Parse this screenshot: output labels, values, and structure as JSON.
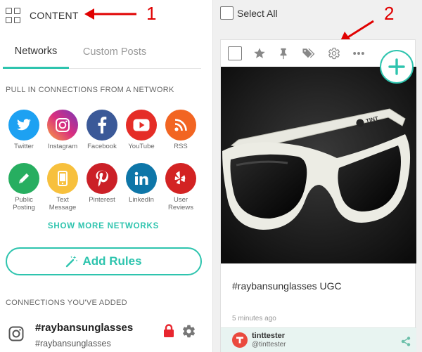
{
  "left_panel": {
    "header_title": "CONTENT",
    "tabs": [
      {
        "label": "Networks",
        "active": true
      },
      {
        "label": "Custom Posts",
        "active": false
      }
    ],
    "section_pull_label": "PULL IN CONNECTIONS FROM A NETWORK",
    "networks": [
      {
        "label": "Twitter",
        "icon": "twitter-icon",
        "color": "#1da1f2"
      },
      {
        "label": "Instagram",
        "icon": "instagram-icon",
        "color": "#c13584"
      },
      {
        "label": "Facebook",
        "icon": "facebook-icon",
        "color": "#3b5998"
      },
      {
        "label": "YouTube",
        "icon": "youtube-icon",
        "color": "#e52d27"
      },
      {
        "label": "RSS",
        "icon": "rss-icon",
        "color": "#f26522"
      },
      {
        "label": "Public\nPosting",
        "icon": "pencil-icon",
        "color": "#27ae60"
      },
      {
        "label": "Text\nMessage",
        "icon": "phone-icon",
        "color": "#f7c03d"
      },
      {
        "label": "Pinterest",
        "icon": "pinterest-icon",
        "color": "#cb2027"
      },
      {
        "label": "LinkedIn",
        "icon": "linkedin-icon",
        "color": "#0e76a8"
      },
      {
        "label": "User\nReviews",
        "icon": "yelp-icon",
        "color": "#d32323"
      }
    ],
    "show_more_label": "SHOW MORE NETWORKS",
    "add_rules_label": "Add Rules",
    "section_added_label": "CONNECTIONS YOU'VE ADDED",
    "connection": {
      "name": "#raybansunglasses",
      "sub": "#raybansunglasses",
      "icon": "instagram-icon"
    }
  },
  "annotations": {
    "arrow1_number": "1",
    "arrow2_number": "2",
    "color": "#e00000"
  },
  "right_panel": {
    "select_all_label": "Select All",
    "card": {
      "toolbar_icons": [
        "checkbox",
        "star-icon",
        "pin-icon",
        "tags-icon",
        "gear-icon",
        "more-icon"
      ],
      "caption": "#raybansunglasses UGC",
      "time": "5 minutes ago",
      "username": "tinttester",
      "handle": "@tinttester",
      "photo_text": "TINT"
    }
  },
  "accent_color": "#2ec4ae"
}
